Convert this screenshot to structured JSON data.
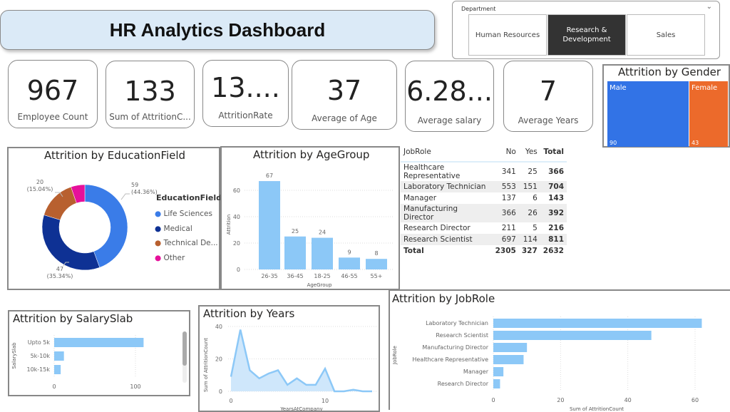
{
  "header": {
    "title": "HR Analytics Dashboard"
  },
  "slicer": {
    "label": "Department",
    "options": [
      "Human Resources",
      "Research & Development",
      "Sales"
    ],
    "selected": "Research & Development"
  },
  "kpis": [
    {
      "value": "967",
      "label": "Employee Count"
    },
    {
      "value": "133",
      "label": "Sum of AttritionC..."
    },
    {
      "value": "13....",
      "label": "AttritionRate"
    },
    {
      "value": "37",
      "label": "Average of Age"
    },
    {
      "value": "6.28...",
      "label": "Average salary"
    },
    {
      "value": "7",
      "label": "Average Years"
    }
  ],
  "colors": {
    "accent": "#8cc8f7",
    "male": "#3273e6",
    "female": "#ec6a2b",
    "life": "#3a7ce8",
    "medical": "#0e3194",
    "technical": "#b8602f",
    "other": "#e6109a"
  },
  "chart_data": [
    {
      "type": "treemap",
      "title": "Attrition by Gender",
      "categories": [
        "Male",
        "Female"
      ],
      "values": [
        90,
        43
      ]
    },
    {
      "type": "pie",
      "title": "Attrition by EducationField",
      "legend_title": "EducationField",
      "categories": [
        "Life Sciences",
        "Medical",
        "Technical De...",
        "Other"
      ],
      "values": [
        59,
        47,
        20,
        7
      ],
      "data_labels": [
        "59\n(44.36%)",
        "47\n(35.34%)",
        "20\n(15.04%)",
        ""
      ],
      "legend": "right"
    },
    {
      "type": "bar",
      "title": "Attrition by AgeGroup",
      "categories": [
        "26-35",
        "36-45",
        "18-25",
        "46-55",
        "55+"
      ],
      "values": [
        67,
        25,
        24,
        9,
        8
      ],
      "xlabel": "AgeGroup",
      "ylabel": "Attrition",
      "yticks": [
        0,
        20,
        40,
        60
      ],
      "ylim": [
        0,
        70
      ]
    },
    {
      "type": "table",
      "columns": [
        "JobRole",
        "No",
        "Yes",
        "Total"
      ],
      "rows": [
        [
          "Healthcare Representative",
          "341",
          "25",
          "366"
        ],
        [
          "Laboratory Technician",
          "553",
          "151",
          "704"
        ],
        [
          "Manager",
          "137",
          "6",
          "143"
        ],
        [
          "Manufacturing Director",
          "366",
          "26",
          "392"
        ],
        [
          "Research Director",
          "211",
          "5",
          "216"
        ],
        [
          "Research Scientist",
          "697",
          "114",
          "811"
        ]
      ],
      "total": [
        "Total",
        "2305",
        "327",
        "2632"
      ]
    },
    {
      "type": "bar",
      "orientation": "horizontal",
      "title": "Attrition by SalarySlab",
      "categories": [
        "Upto 5k",
        "5k-10k",
        "10k-15k"
      ],
      "values": [
        110,
        12,
        8
      ],
      "ylabel": "SalarySlab",
      "xticks": [
        0,
        100
      ]
    },
    {
      "type": "area",
      "title": "Attrition by Years",
      "x": [
        0,
        1,
        2,
        3,
        4,
        5,
        6,
        7,
        8,
        9,
        10,
        11,
        12,
        13,
        14,
        15
      ],
      "values": [
        9,
        38,
        13,
        8,
        11,
        13,
        4,
        8,
        4,
        4,
        14,
        0,
        0,
        1,
        0,
        0
      ],
      "xlabel": "YearsAtCompany",
      "ylabel": "Sum of AttritionCount",
      "yticks": [
        0,
        20,
        40
      ],
      "xticks": [
        0,
        10
      ]
    },
    {
      "type": "bar",
      "orientation": "horizontal",
      "title": "Attrition by JobRole",
      "categories": [
        "Laboratory Technician",
        "Research Scientist",
        "Manufacturing Director",
        "Healthcare Representative",
        "Manager",
        "Research Director"
      ],
      "values": [
        62,
        47,
        10,
        9,
        3,
        2
      ],
      "xlabel": "Sum of AttritionCount",
      "ylabel": "JobRole",
      "xticks": [
        0,
        20,
        40,
        60
      ]
    }
  ]
}
